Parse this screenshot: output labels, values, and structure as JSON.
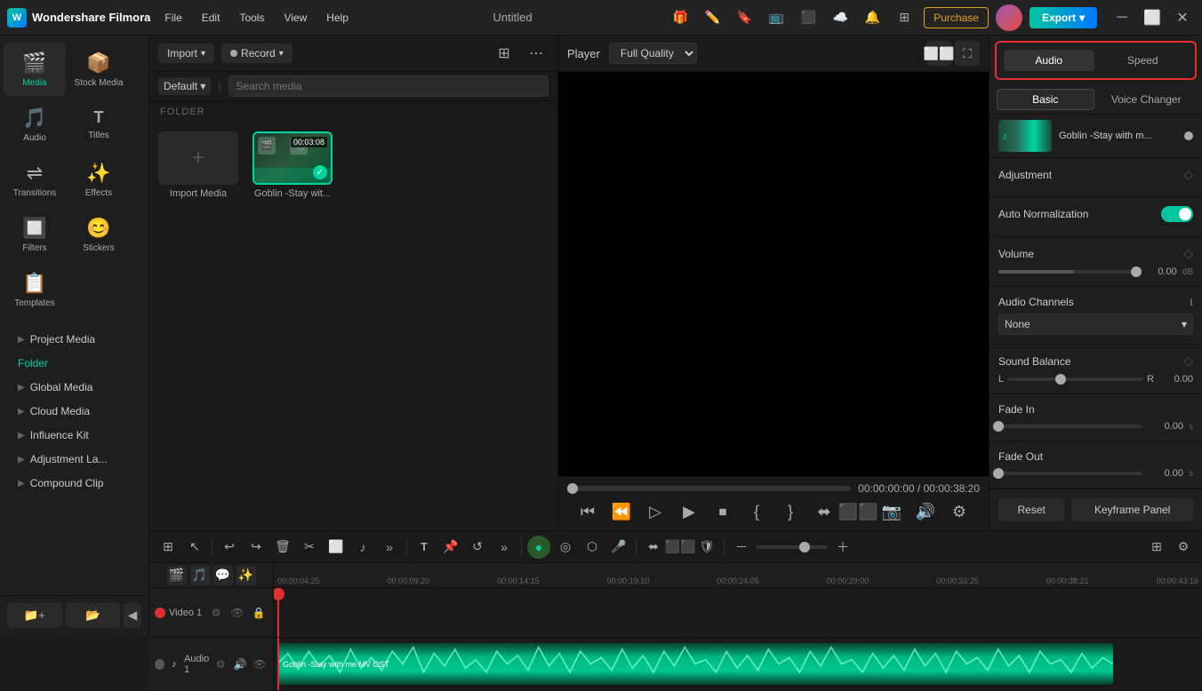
{
  "app": {
    "name": "Wondershare Filmora",
    "title": "Untitled",
    "logo_char": "W"
  },
  "menu": {
    "items": [
      "File",
      "Edit",
      "Tools",
      "View",
      "Help"
    ]
  },
  "top_buttons": {
    "purchase": "Purchase",
    "export": "Export"
  },
  "nav_icons": [
    {
      "id": "media",
      "label": "Media",
      "icon": "🎬",
      "active": true
    },
    {
      "id": "stock-media",
      "label": "Stock Media",
      "icon": "📦"
    },
    {
      "id": "audio",
      "label": "Audio",
      "icon": "🎵"
    },
    {
      "id": "titles",
      "label": "Titles",
      "icon": "T"
    },
    {
      "id": "transitions",
      "label": "Transitions",
      "icon": "⇌"
    },
    {
      "id": "effects",
      "label": "Effects",
      "icon": "✨"
    },
    {
      "id": "filters",
      "label": "Filters",
      "icon": "🔲"
    },
    {
      "id": "stickers",
      "label": "Stickers",
      "icon": "😊"
    },
    {
      "id": "templates",
      "label": "Templates",
      "icon": "📋"
    }
  ],
  "sidebar_tree": [
    {
      "id": "project-media",
      "label": "Project Media",
      "active": false
    },
    {
      "id": "folder",
      "label": "Folder",
      "active": true
    },
    {
      "id": "global-media",
      "label": "Global Media",
      "active": false
    },
    {
      "id": "cloud-media",
      "label": "Cloud Media",
      "active": false
    },
    {
      "id": "influence-kit",
      "label": "Influence Kit",
      "active": false
    },
    {
      "id": "adjustment-la",
      "label": "Adjustment La...",
      "active": false
    },
    {
      "id": "compound-clip",
      "label": "Compound Clip",
      "active": false
    }
  ],
  "media_panel": {
    "import_label": "Import",
    "record_label": "Record",
    "default_label": "Default",
    "search_placeholder": "Search media",
    "folder_label": "FOLDER",
    "items": [
      {
        "id": "import-media",
        "label": "Import Media",
        "type": "add"
      },
      {
        "id": "goblin",
        "label": "Goblin -Stay wit...",
        "type": "video",
        "duration": "00:03:08",
        "selected": true
      }
    ]
  },
  "player": {
    "label": "Player",
    "quality": "Full Quality",
    "time_current": "00:00:00:00",
    "time_total": "00:00:38:20"
  },
  "right_panel": {
    "tabs": [
      "Audio",
      "Speed"
    ],
    "sub_tabs": [
      "Basic",
      "Voice Changer"
    ],
    "track_title": "Goblin -Stay with m...",
    "sections": {
      "adjustment": {
        "label": "Adjustment"
      },
      "auto_normalization": {
        "label": "Auto Normalization",
        "enabled": true
      },
      "volume": {
        "label": "Volume",
        "value": "0.00",
        "unit": "dB"
      },
      "audio_channels": {
        "label": "Audio Channels",
        "value": "None"
      },
      "sound_balance": {
        "label": "Sound Balance",
        "left_label": "L",
        "right_label": "R",
        "value": "0.00"
      },
      "fade_in": {
        "label": "Fade In",
        "value": "0.00",
        "unit": "s"
      },
      "fade_out": {
        "label": "Fade Out",
        "value": "0.00",
        "unit": "s"
      }
    },
    "reset_label": "Reset",
    "keyframe_label": "Keyframe Panel"
  },
  "timeline": {
    "tracks": [
      {
        "id": "video1",
        "label": "Video 1",
        "type": "video"
      },
      {
        "id": "audio1",
        "label": "Audio 1",
        "type": "audio",
        "clip_label": "Goblin -Stay with me MV OST"
      }
    ],
    "time_markers": [
      "00:00:04:25",
      "00:00:09:20",
      "00:00:14:15",
      "00:00:19:10",
      "00:00:24:05",
      "00:00:29:00",
      "00:00:33:25",
      "00:00:38:21",
      "00:00:43:16"
    ]
  }
}
